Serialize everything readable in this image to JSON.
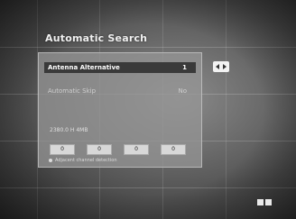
{
  "screen": {
    "title": "Automatic Search"
  },
  "menu": {
    "rows": [
      {
        "label": "Antenna Alternative",
        "value": "1",
        "selected": true
      },
      {
        "label": "Automatic Skip",
        "value": "No",
        "selected": false
      }
    ]
  },
  "frequency": "2380.0 H 4MB",
  "buttons": [
    "0",
    "0",
    "0",
    "0"
  ],
  "legend": "Adjacent channel detection",
  "icons": {
    "left_right": "left-right-arrows-icon",
    "corner": "double-square-icon"
  }
}
